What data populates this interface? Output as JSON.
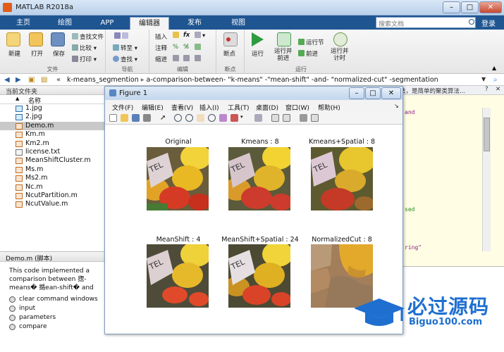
{
  "app": {
    "title": "MATLAB R2018a"
  },
  "tabs": [
    "主页",
    "绘图",
    "APP",
    "编辑器",
    "发布",
    "视图"
  ],
  "active_tab": "编辑器",
  "search": {
    "placeholder": "搜索文档"
  },
  "login_label": "登录",
  "ribbon": {
    "file": {
      "label": "文件",
      "new": "新建",
      "open": "打开",
      "save": "保存",
      "find_files": "查找文件",
      "compare": "比较",
      "print": "打印"
    },
    "navigate": {
      "label": "导航",
      "goto": "转至",
      "find": "查找"
    },
    "edit": {
      "label": "编辑",
      "insert": "插入",
      "comment": "注释",
      "indent": "缩进",
      "fx": "fx"
    },
    "breakpoints": {
      "label": "断点",
      "breakpoints": "断点"
    },
    "run": {
      "label": "运行",
      "run": "运行",
      "run_advance": "运行并\n前进",
      "run_section": "运行节",
      "advance": "前进",
      "run_time": "运行并\n计时"
    }
  },
  "address": {
    "crumbs": [
      "k-means_segmention",
      "a-comparison-between- \"k-means\" -\"mean-shift\" -and- \"normalized-cut\" -segmentation"
    ]
  },
  "left_pane": {
    "title": "当前文件夹",
    "col_name": "名称",
    "files": [
      {
        "name": "1.jpg",
        "type": "j"
      },
      {
        "name": "2.jpg",
        "type": "j"
      },
      {
        "name": "Demo.m",
        "type": "m",
        "selected": true
      },
      {
        "name": "Km.m",
        "type": "m"
      },
      {
        "name": "Km2.m",
        "type": "m"
      },
      {
        "name": "license.txt",
        "type": "t"
      },
      {
        "name": "MeanShiftCluster.m",
        "type": "m"
      },
      {
        "name": "Ms.m",
        "type": "m"
      },
      {
        "name": "Ms2.m",
        "type": "m"
      },
      {
        "name": "Nc.m",
        "type": "m"
      },
      {
        "name": "NcutPartition.m",
        "type": "m"
      },
      {
        "name": "NcutValue.m",
        "type": "m"
      }
    ]
  },
  "details": {
    "title": "Demo.m  (脚本)",
    "description": "This code implemented a comparison between 揔-means� 揗ean-shift� and",
    "sections": [
      "clear command windows",
      "input",
      "parameters",
      "compare"
    ]
  },
  "right_pane": {
    "header": "法，是简单的聚类算法...",
    "code_lines": [
      "and",
      "sed",
      "ring\""
    ]
  },
  "figure": {
    "title": "Figure 1",
    "menus": [
      "文件(F)",
      "编辑(E)",
      "查看(V)",
      "插入(I)",
      "工具(T)",
      "桌面(D)",
      "窗口(W)",
      "帮助(H)"
    ],
    "plots": [
      {
        "title": "Original"
      },
      {
        "title": "Kmeans : 8"
      },
      {
        "title": "Kmeans+Spatial : 8"
      },
      {
        "title": "MeanShift : 4"
      },
      {
        "title": "MeanShift+Spatial : 24"
      },
      {
        "title": "NormalizedCut : 8"
      }
    ]
  },
  "watermark": {
    "text": "必过源码",
    "url": "Biguo100.com"
  }
}
